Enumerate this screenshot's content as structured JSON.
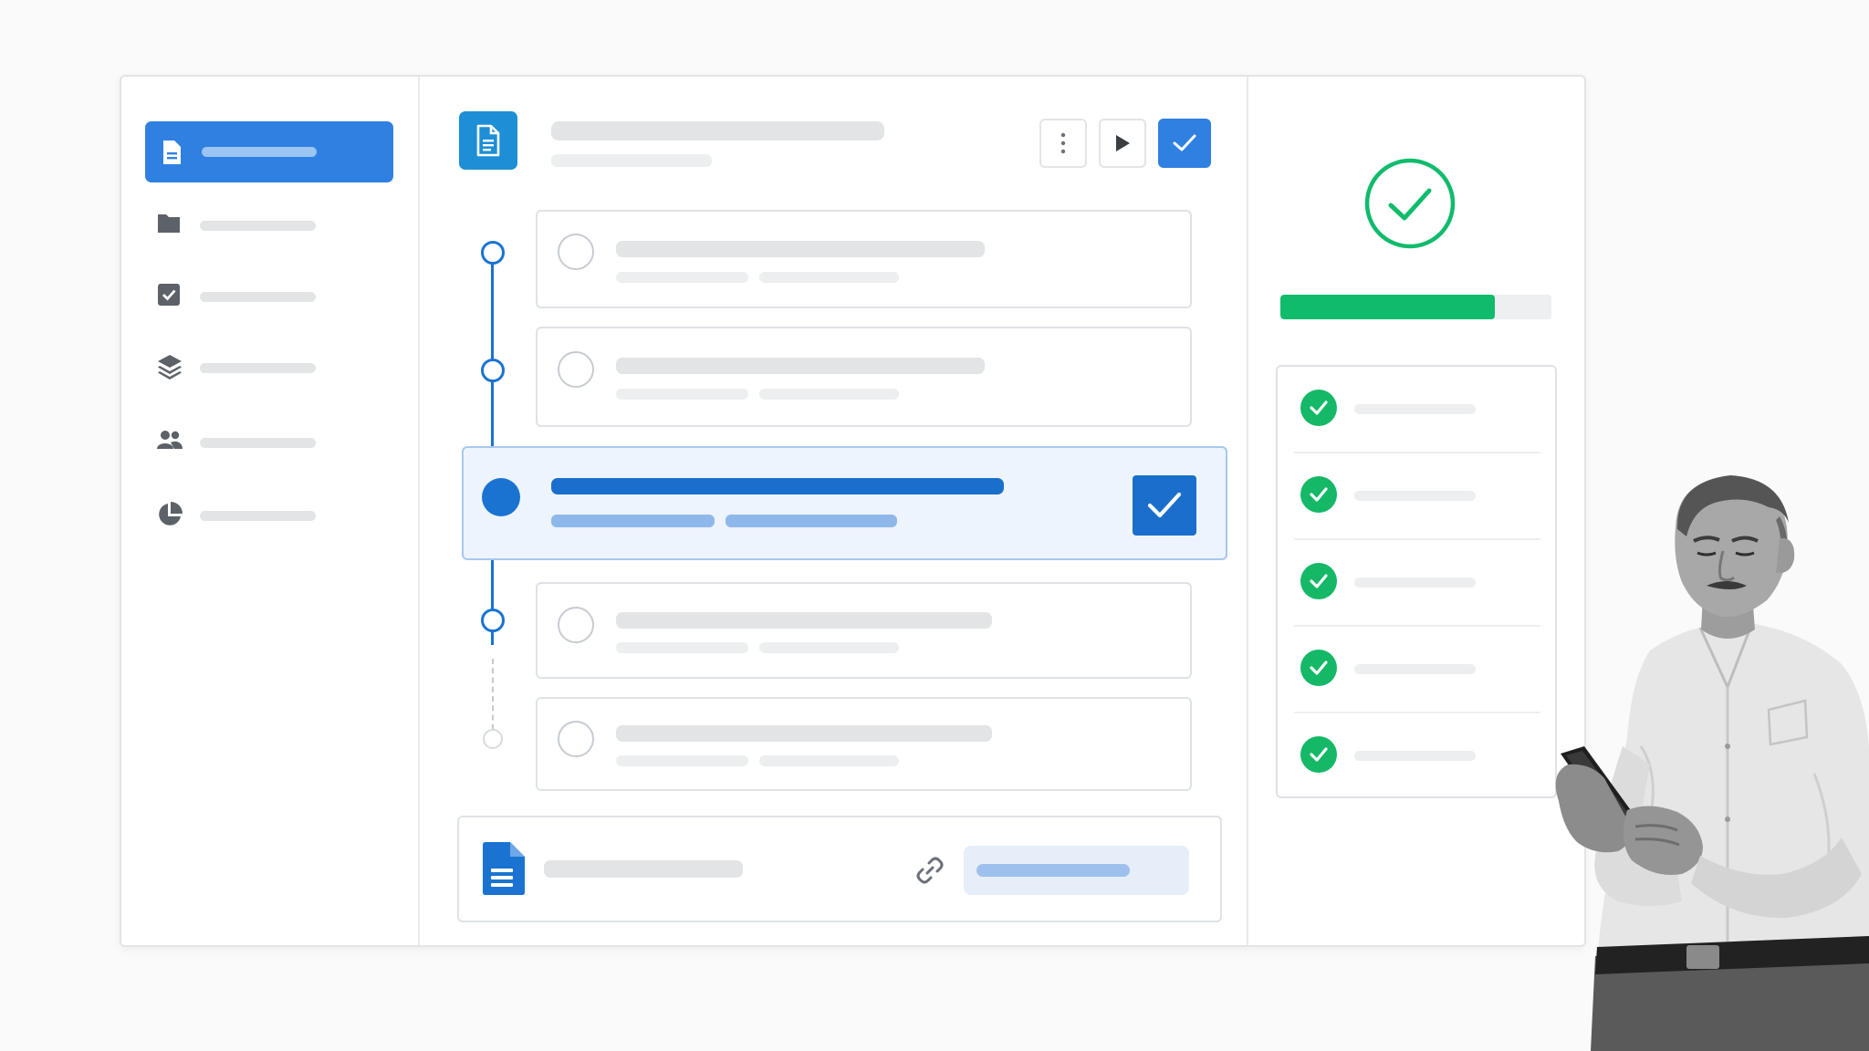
{
  "window": {
    "sidebar": {
      "items": [
        {
          "icon": "document-icon",
          "active": true
        },
        {
          "icon": "folder-icon"
        },
        {
          "icon": "checkbox-icon"
        },
        {
          "icon": "layers-icon"
        },
        {
          "icon": "users-icon"
        },
        {
          "icon": "pie-chart-icon"
        }
      ]
    },
    "header": {
      "icon": "document-icon",
      "toolbar": [
        "more-vertical-icon",
        "play-icon",
        "check-icon"
      ]
    },
    "steps": [
      {
        "state": "pending"
      },
      {
        "state": "pending"
      },
      {
        "state": "active",
        "checked": true
      },
      {
        "state": "pending"
      },
      {
        "state": "pending"
      }
    ],
    "attachment": {
      "icon": "google-doc-icon",
      "link_icon": "link-icon"
    },
    "status": {
      "icon": "check-circle-icon",
      "progress_fraction": 0.79,
      "checklist_done": [
        true,
        true,
        true,
        true,
        true
      ]
    }
  },
  "colors": {
    "accent": "#2f80e1",
    "active_blue": "#1a73d1",
    "success_green": "#10bb6c",
    "border": "#dfe2e6",
    "skeleton": "#e3e4e6"
  },
  "illustration": {
    "subject": "person-with-phone-illustration"
  }
}
